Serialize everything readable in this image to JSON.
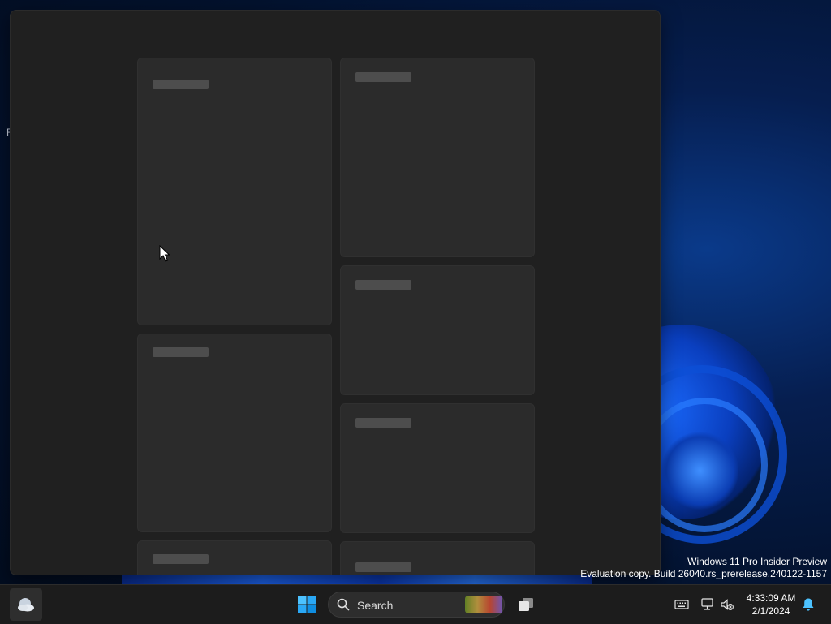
{
  "desktop": {
    "edge_char": "F"
  },
  "watermark": {
    "line1": "Windows 11 Pro Insider Preview",
    "line2": "Evaluation copy. Build 26040.rs_prerelease.240122-1157"
  },
  "taskbar": {
    "search_label": "Search",
    "clock_time": "4:33:09 AM",
    "clock_date": "2/1/2024",
    "icons": [
      "widgets-icon",
      "start-icon",
      "search-icon",
      "task-view-icon",
      "keyboard-icon",
      "network-icon",
      "volume-muted-icon",
      "notification-bell-icon"
    ]
  },
  "colors": {
    "panel": "#202020",
    "card": "#2b2b2b",
    "placeholder": "#4d4d4d",
    "taskbar": "#1c1c1c",
    "accent": "#0078d4"
  }
}
